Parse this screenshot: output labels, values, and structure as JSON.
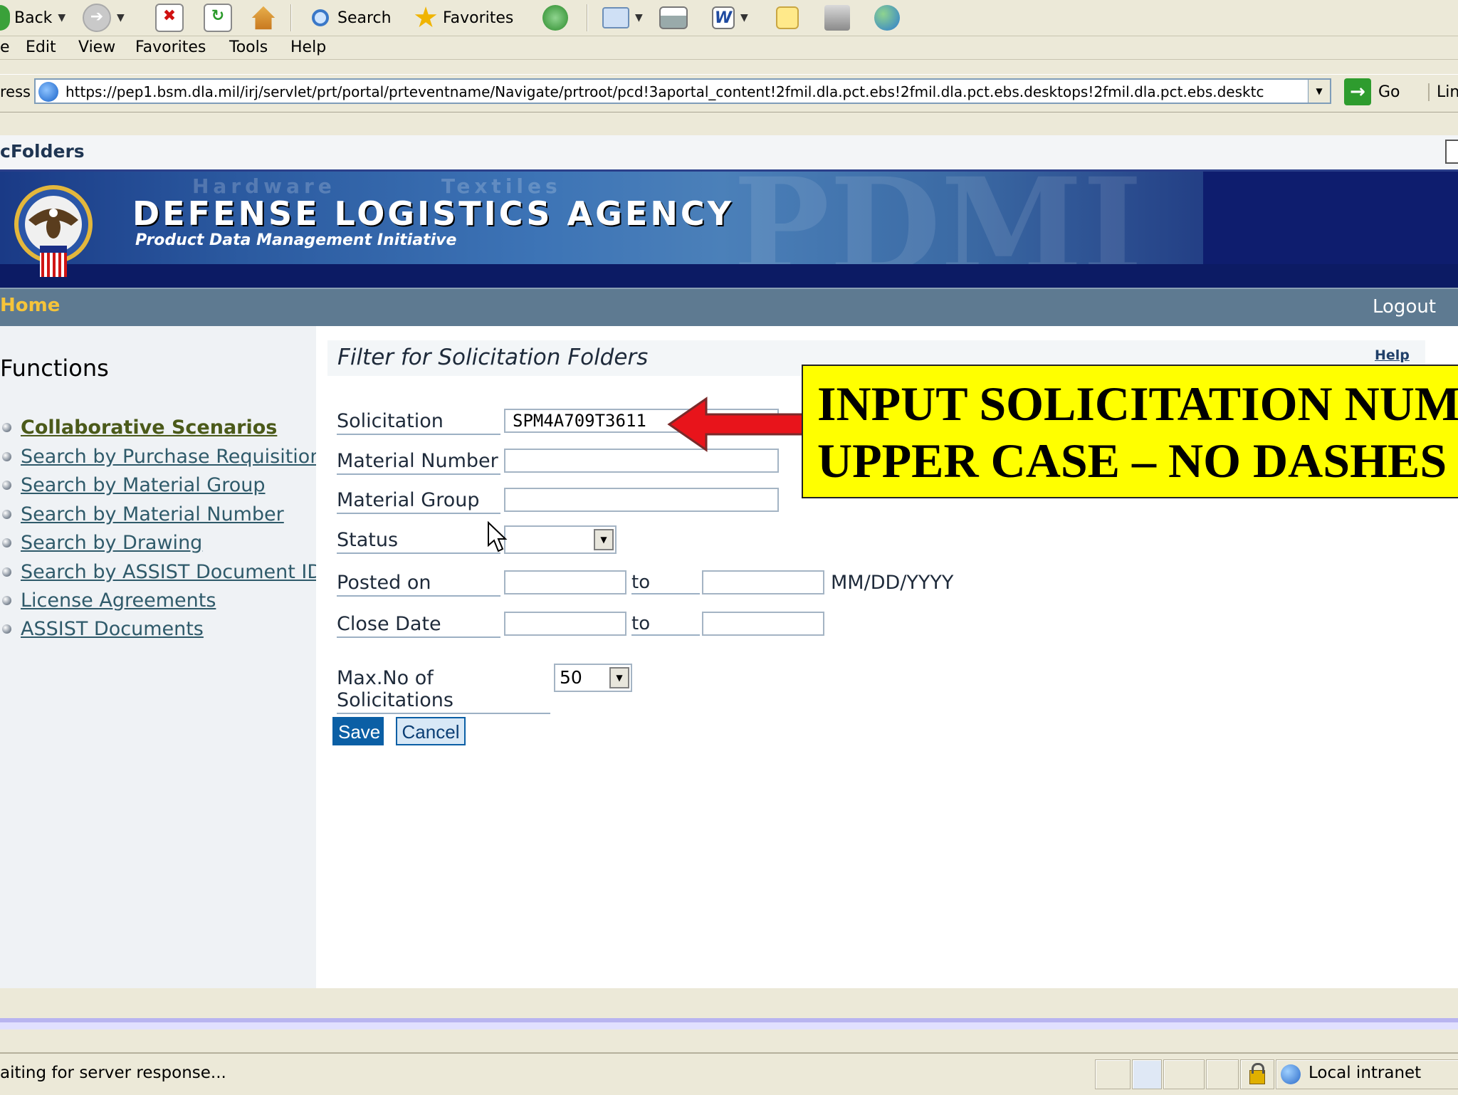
{
  "toolbar": {
    "back_label": "Back",
    "search_label": "Search",
    "favorites_label": "Favorites"
  },
  "menu": [
    "e",
    "Edit",
    "View",
    "Favorites",
    "Tools",
    "Help"
  ],
  "address": {
    "label": "ress",
    "url": "https://pep1.bsm.dla.mil/irj/servlet/prt/portal/prteventname/Navigate/prtroot/pcd!3aportal_content!2fmil.dla.pct.ebs!2fmil.dla.pct.ebs.desktops!2fmil.dla.pct.ebs.desktc",
    "go_label": "Go",
    "links_label": "Lin"
  },
  "portal": {
    "title": "cFolders",
    "agency": "DEFENSE LOGISTICS AGENCY",
    "subtitle": "Product Data Management Initiative",
    "nav_home": "Home",
    "nav_logout": "Logout"
  },
  "sidebar": {
    "title": "Functions",
    "items": [
      {
        "label": "Collaborative Scenarios"
      },
      {
        "label": "Search by Purchase Requisition"
      },
      {
        "label": "Search by Material Group"
      },
      {
        "label": "Search by Material Number"
      },
      {
        "label": "Search by Drawing"
      },
      {
        "label": "Search by ASSIST Document ID"
      },
      {
        "label": "License Agreements"
      },
      {
        "label": "ASSIST Documents"
      }
    ]
  },
  "form": {
    "title": "Filter for Solicitation Folders",
    "help": "Help",
    "solicitation_label": "Solicitation",
    "solicitation_value": "SPM4A709T3611",
    "material_number_label": "Material Number",
    "material_number_value": "",
    "material_group_label": "Material Group",
    "material_group_value": "",
    "status_label": "Status",
    "status_value": "",
    "posted_on_label": "Posted on",
    "close_date_label": "Close Date",
    "to_label": "to",
    "date_format": "MM/DD/YYYY",
    "max_label": "Max.No of Solicitations",
    "max_value": "50",
    "save_label": "Save",
    "cancel_label": "Cancel"
  },
  "callout": {
    "line1": "INPUT SOLICITATION NUM",
    "line2": "UPPER CASE – NO DASHES"
  },
  "status": {
    "text": "aiting for server response...",
    "zone": "Local intranet"
  },
  "colors": {
    "nav_bar": "#5e7a91",
    "home_link": "#f5c43a",
    "banner": "#0e1d6e",
    "callout": "#ffff00",
    "arrow": "#e8141b",
    "save_button": "#0b5fa5"
  }
}
